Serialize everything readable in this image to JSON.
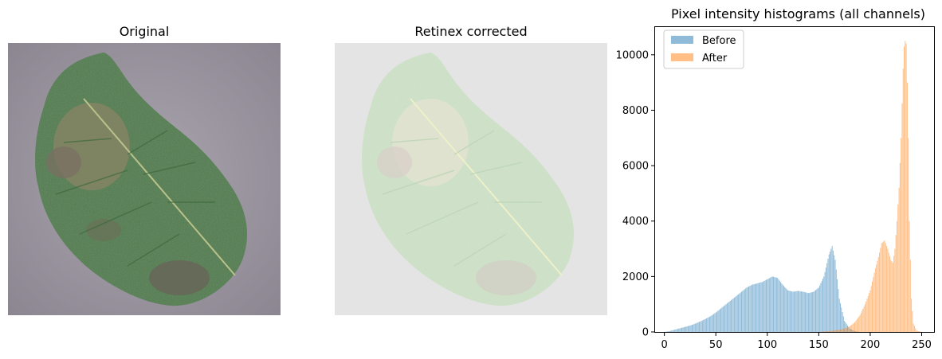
{
  "panels": {
    "original_title": "Original",
    "corrected_title": "Retinex corrected"
  },
  "chart_data": {
    "type": "bar",
    "title": "Pixel intensity histograms (all channels)",
    "xlabel": "",
    "ylabel": "",
    "xlim": [
      -9,
      262
    ],
    "ylim": [
      0,
      11000
    ],
    "xticks": [
      0,
      50,
      100,
      150,
      200,
      250
    ],
    "yticks": [
      0,
      2000,
      4000,
      6000,
      8000,
      10000
    ],
    "grid": false,
    "legend_position": "top-left",
    "series": [
      {
        "name": "Before",
        "color": "#1f77b4",
        "opacity": 0.5,
        "x": [
          0,
          5,
          10,
          15,
          20,
          25,
          30,
          35,
          40,
          45,
          50,
          55,
          60,
          65,
          70,
          75,
          80,
          85,
          90,
          95,
          100,
          105,
          110,
          115,
          120,
          125,
          130,
          135,
          140,
          145,
          150,
          155,
          160,
          163,
          166,
          170,
          175,
          180,
          185,
          190
        ],
        "values": [
          0,
          30,
          80,
          130,
          180,
          230,
          300,
          380,
          470,
          570,
          700,
          850,
          1000,
          1150,
          1300,
          1450,
          1600,
          1700,
          1750,
          1800,
          1900,
          2000,
          1950,
          1700,
          1500,
          1450,
          1480,
          1450,
          1400,
          1450,
          1600,
          2000,
          2800,
          3100,
          2600,
          1200,
          400,
          120,
          30,
          0
        ]
      },
      {
        "name": "After",
        "color": "#ff7f0e",
        "opacity": 0.5,
        "x": [
          150,
          160,
          170,
          175,
          180,
          185,
          190,
          195,
          200,
          205,
          208,
          211,
          214,
          217,
          220,
          222,
          224,
          226,
          228,
          230,
          232,
          233,
          234,
          235,
          236,
          237,
          238,
          240,
          242,
          245,
          250
        ],
        "values": [
          0,
          30,
          80,
          120,
          200,
          350,
          600,
          1000,
          1500,
          2300,
          2700,
          3200,
          3300,
          3000,
          2600,
          2500,
          3000,
          4000,
          5200,
          7000,
          9500,
          10300,
          10500,
          10400,
          9000,
          7000,
          4000,
          1200,
          300,
          50,
          0
        ]
      }
    ]
  }
}
